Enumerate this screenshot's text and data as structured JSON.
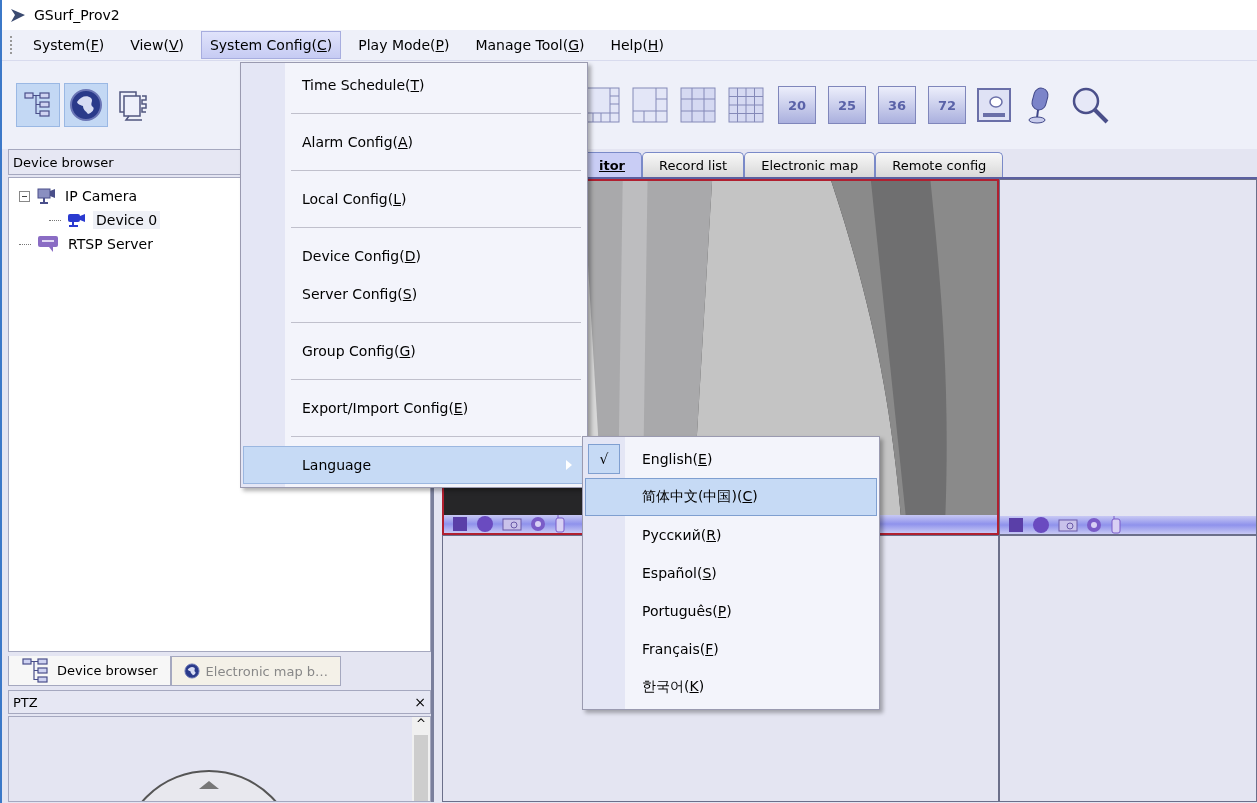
{
  "window": {
    "title": "GSurf_Prov2"
  },
  "menu_bar": [
    {
      "label": "System(F)",
      "selected": false
    },
    {
      "label": "View(V)",
      "selected": false
    },
    {
      "label": "System Config(C)",
      "selected": true
    },
    {
      "label": "Play Mode(P)",
      "selected": false
    },
    {
      "label": "Manage Tool(G)",
      "selected": false
    },
    {
      "label": "Help(H)",
      "selected": false
    }
  ],
  "toolbar": {
    "left": [
      {
        "kind": "tree",
        "selected": true
      },
      {
        "kind": "globe",
        "selected": true
      },
      {
        "kind": "document",
        "selected": false
      }
    ],
    "right": [
      {
        "kind": "layout-8"
      },
      {
        "kind": "layout-6"
      },
      {
        "kind": "grid-9"
      },
      {
        "kind": "grid-16"
      },
      {
        "kind": "number",
        "label": "20"
      },
      {
        "kind": "number",
        "label": "25"
      },
      {
        "kind": "number",
        "label": "36"
      },
      {
        "kind": "number",
        "label": "72"
      },
      {
        "kind": "screen"
      },
      {
        "kind": "microphone"
      },
      {
        "kind": "search"
      }
    ]
  },
  "device_browser": {
    "title": "Device browser",
    "tree": [
      {
        "label": "IP Camera",
        "kind": "camera-group",
        "expanded": true,
        "selected": false,
        "children": [
          {
            "label": "Device 0",
            "kind": "camera",
            "selected": true
          }
        ]
      },
      {
        "label": "RTSP Server",
        "kind": "server",
        "selected": false
      }
    ]
  },
  "panel_tabs": [
    {
      "label": "Device browser",
      "kind": "tree",
      "selected": true
    },
    {
      "label": "Electronic map b…",
      "kind": "globe",
      "selected": false
    }
  ],
  "ptz": {
    "title": "PTZ",
    "close": "×",
    "scroll_up": "^"
  },
  "view_tabs": [
    {
      "label": "itor",
      "selected": true
    },
    {
      "label": "Record list",
      "selected": false
    },
    {
      "label": "Electronic map",
      "selected": false
    },
    {
      "label": "Remote config",
      "selected": false
    }
  ],
  "video_cells": [
    {
      "kind": "picture",
      "active": true,
      "controls": true
    },
    {
      "kind": "empty",
      "active": false,
      "controls": true
    },
    {
      "kind": "empty",
      "active": false,
      "controls": false
    },
    {
      "kind": "empty",
      "active": false,
      "controls": false
    }
  ],
  "system_config_menu": [
    {
      "kind": "item",
      "label": "Time Schedule(T)",
      "selected": false
    },
    {
      "kind": "separator"
    },
    {
      "kind": "item",
      "label": "Alarm Config(A)",
      "selected": false
    },
    {
      "kind": "separator"
    },
    {
      "kind": "item",
      "label": "Local Config(L)",
      "selected": false
    },
    {
      "kind": "separator"
    },
    {
      "kind": "item",
      "label": "Device Config(D)",
      "selected": false
    },
    {
      "kind": "item",
      "label": "Server Config(S)",
      "selected": false
    },
    {
      "kind": "separator"
    },
    {
      "kind": "item",
      "label": "Group Config(G)",
      "selected": false
    },
    {
      "kind": "separator"
    },
    {
      "kind": "item",
      "label": "Export/Import Config(E)",
      "selected": false
    },
    {
      "kind": "separator"
    },
    {
      "kind": "submenu",
      "label": "Language",
      "selected": true
    }
  ],
  "language_menu": [
    {
      "label": "English(E)",
      "checked": true,
      "selected": false,
      "check": "√"
    },
    {
      "label": "简体中文(中国)(C)",
      "checked": false,
      "selected": true
    },
    {
      "label": "Русский(R)",
      "checked": false,
      "selected": false
    },
    {
      "label": "Español(S)",
      "checked": false,
      "selected": false
    },
    {
      "label": "Português(P)",
      "checked": false,
      "selected": false
    },
    {
      "label": "Français(F)",
      "checked": false,
      "selected": false
    },
    {
      "label": "한국어(K)",
      "checked": false,
      "selected": false
    }
  ]
}
